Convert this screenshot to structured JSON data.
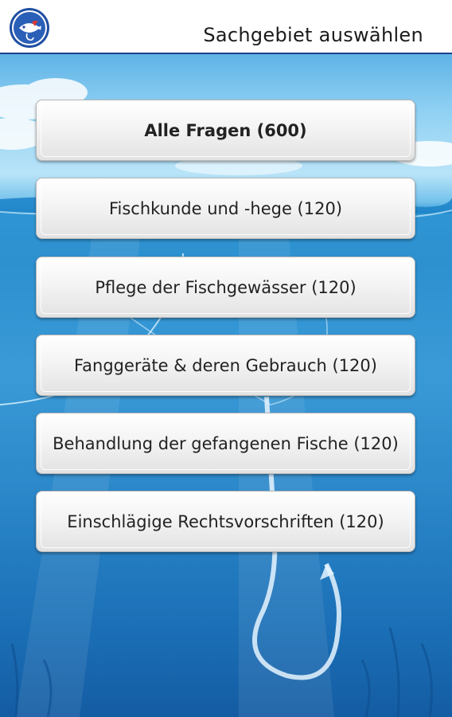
{
  "header": {
    "title": "Sachgebiet auswählen",
    "logo_icon": "fish-logo-icon"
  },
  "topics": [
    {
      "label": "Alle Fragen (600)"
    },
    {
      "label": "Fischkunde und -hege (120)"
    },
    {
      "label": "Pflege der Fischgewässer (120)"
    },
    {
      "label": "Fanggeräte & deren Gebrauch (120)"
    },
    {
      "label": "Behandlung der gefangenen Fische (120)"
    },
    {
      "label": "Einschlägige Rechtsvorschriften (120)"
    }
  ],
  "colors": {
    "header_rule": "#1f3f8a",
    "water_top": "#2f95d4",
    "water_bottom": "#145ca3"
  }
}
